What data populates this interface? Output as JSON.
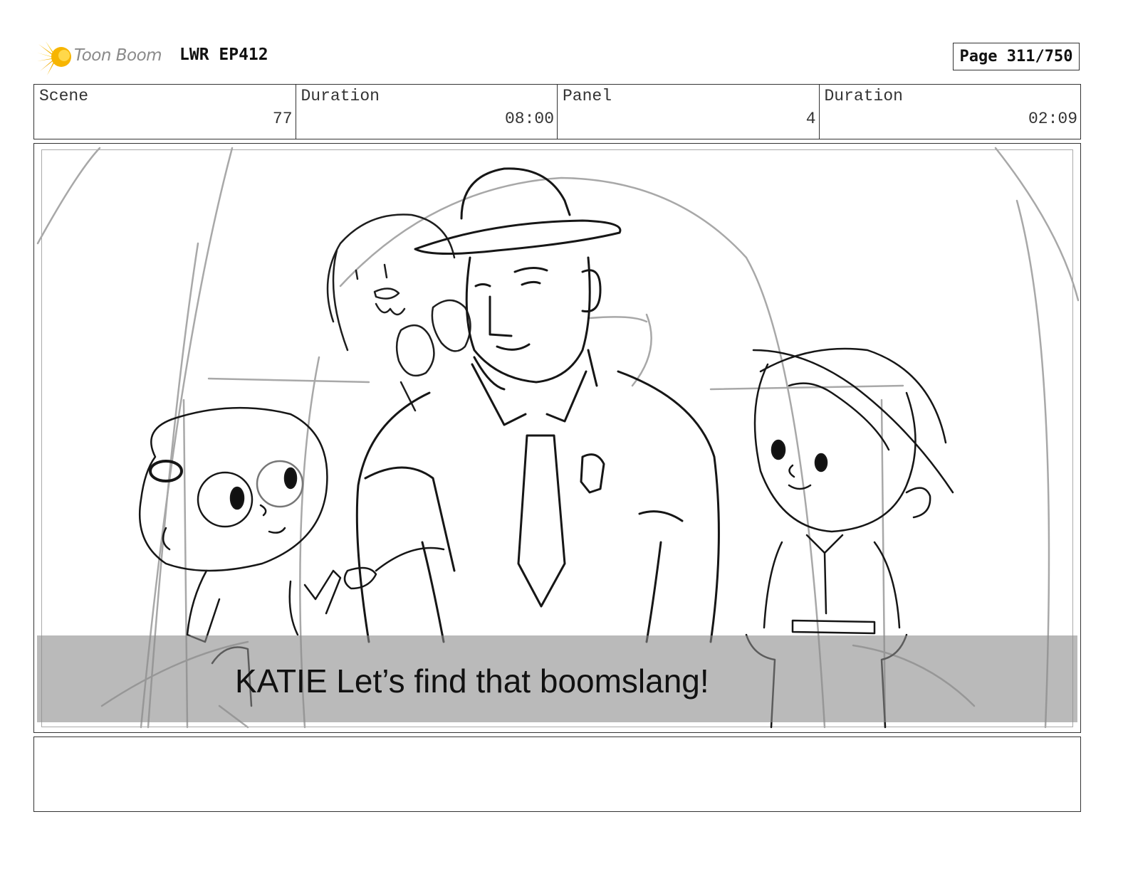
{
  "header": {
    "logo_text": "Toon Boom",
    "project_title": "LWR EP412",
    "page_label": "Page 311/750"
  },
  "info": [
    {
      "label": "Scene",
      "value": "77"
    },
    {
      "label": "Duration",
      "value": "08:00"
    },
    {
      "label": "Panel",
      "value": "4"
    },
    {
      "label": "Duration",
      "value": "02:09"
    }
  ],
  "panel": {
    "caption": "KATIE Let’s find that boomslang!"
  },
  "notes": {
    "text": ""
  }
}
